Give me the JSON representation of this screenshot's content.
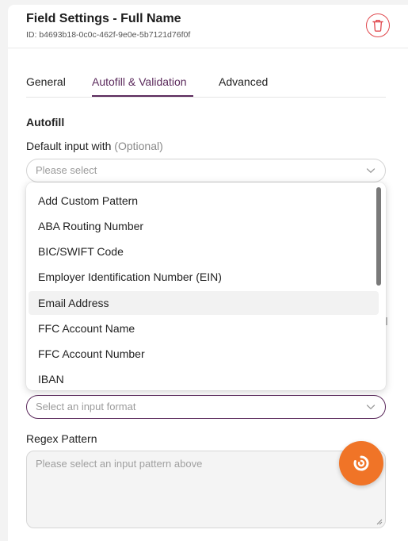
{
  "header": {
    "title": "Field Settings - Full Name",
    "id_text": "ID: b4693b18-0c0c-462f-9e0e-5b7121d76f0f"
  },
  "tabs": [
    {
      "label": "General",
      "active": false
    },
    {
      "label": "Autofill & Validation",
      "active": true
    },
    {
      "label": "Advanced",
      "active": false
    }
  ],
  "autofill": {
    "section_label": "Autofill",
    "default_label": "Default input with",
    "default_optional": "(Optional)",
    "default_placeholder": "Please select"
  },
  "dropdown": {
    "options": [
      "Add Custom Pattern",
      "ABA Routing Number",
      "BIC/SWIFT Code",
      "Employer Identification Number (EIN)",
      "Email Address",
      "FFC Account Name",
      "FFC Account Number",
      "IBAN"
    ],
    "hovered_index": 4
  },
  "format": {
    "placeholder": "Select an input format"
  },
  "regex": {
    "label": "Regex Pattern",
    "placeholder": "Please select an input pattern above"
  },
  "colors": {
    "accent": "#5b2a5c",
    "danger": "#e0474c",
    "fab": "#f07427"
  },
  "icons": {
    "delete": "trash-icon",
    "chevron": "chevron-down-icon",
    "fab": "assistant-icon"
  }
}
